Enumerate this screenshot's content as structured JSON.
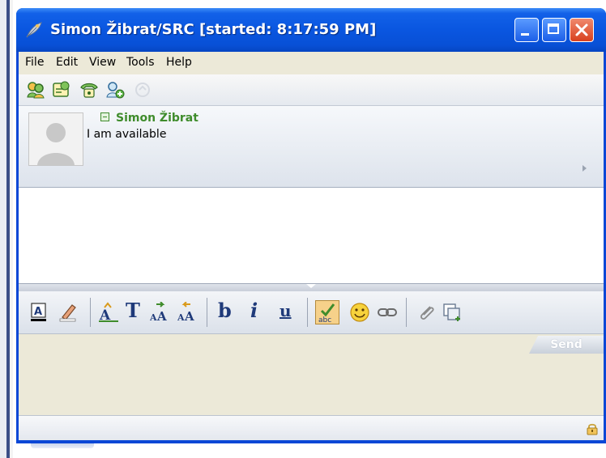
{
  "window": {
    "title": "Simon Žibrat/SRC [started: 8:17:59 PM]",
    "icon": "pidgin-feather-icon"
  },
  "menu": {
    "items": [
      "File",
      "Edit",
      "View",
      "Tools",
      "Help"
    ]
  },
  "toolbar": {
    "icons": [
      "buddies-icon",
      "conversation-info-icon",
      "phone-icon",
      "add-buddy-icon",
      "disabled-transfer-icon"
    ]
  },
  "contact": {
    "name": "Simon Žibrat",
    "status": "I am available"
  },
  "format_toolbar": {
    "icons": [
      "text-color-icon",
      "highlight-pen-icon",
      "font-icon",
      "text-size-icon",
      "grow-font-icon",
      "shrink-font-icon",
      "bold-icon",
      "italic-icon",
      "underline-icon",
      "spellcheck-icon",
      "smiley-icon",
      "link-icon",
      "attachment-icon",
      "insert-image-icon"
    ],
    "bold_glyph": "b",
    "italic_glyph": "i",
    "underline_glyph": "u",
    "font_glyph": "T"
  },
  "composer": {
    "send_label": "Send"
  },
  "colors": {
    "titlebar": "#0a56e0",
    "contact_name": "#3f8c2c",
    "client_bg": "#ece9d8"
  }
}
